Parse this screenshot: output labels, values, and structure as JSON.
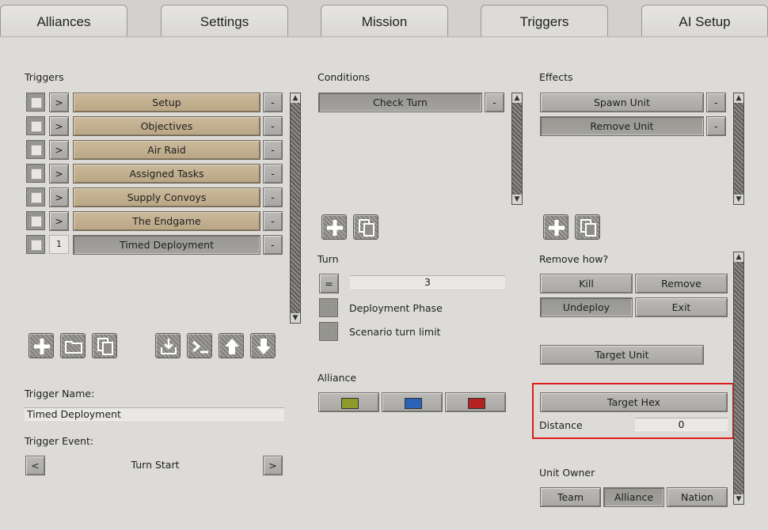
{
  "tabs": [
    {
      "label": "Alliances"
    },
    {
      "label": "Settings"
    },
    {
      "label": "Mission"
    },
    {
      "label": "Triggers"
    },
    {
      "label": "AI Setup"
    }
  ],
  "triggers": {
    "title": "Triggers",
    "expand_label": ">",
    "remove_label": "-",
    "items": [
      {
        "label": "Setup"
      },
      {
        "label": "Objectives"
      },
      {
        "label": "Air Raid"
      },
      {
        "label": "Assigned Tasks"
      },
      {
        "label": "Supply Convoys"
      },
      {
        "label": "The Endgame"
      },
      {
        "label": "Timed Deployment",
        "index": "1"
      }
    ],
    "name_label": "Trigger Name:",
    "name_value": "Timed Deployment",
    "event_label": "Trigger Event:",
    "event_value": "Turn Start",
    "prev": "<",
    "next": ">"
  },
  "conditions": {
    "title": "Conditions",
    "items": [
      {
        "label": "Check Turn"
      }
    ],
    "remove_label": "-",
    "turn_label": "Turn",
    "turn_operator": "=",
    "turn_value": "3",
    "deployment_phase": "Deployment Phase",
    "scenario_turn_limit": "Scenario turn limit",
    "alliance_label": "Alliance",
    "alliance_colors": [
      "#8e9a2a",
      "#2a63b8",
      "#b52222"
    ]
  },
  "effects": {
    "title": "Effects",
    "items": [
      {
        "label": "Spawn Unit"
      },
      {
        "label": "Remove Unit"
      }
    ],
    "remove_label": "-",
    "remove_how_label": "Remove how?",
    "remove_how_options": [
      "Kill",
      "Remove",
      "Undeploy",
      "Exit"
    ],
    "target_unit": "Target Unit",
    "target_hex": "Target Hex",
    "distance_label": "Distance",
    "distance_value": "0",
    "unit_owner_label": "Unit Owner",
    "unit_owner_options": [
      "Team",
      "Alliance",
      "Nation"
    ]
  }
}
